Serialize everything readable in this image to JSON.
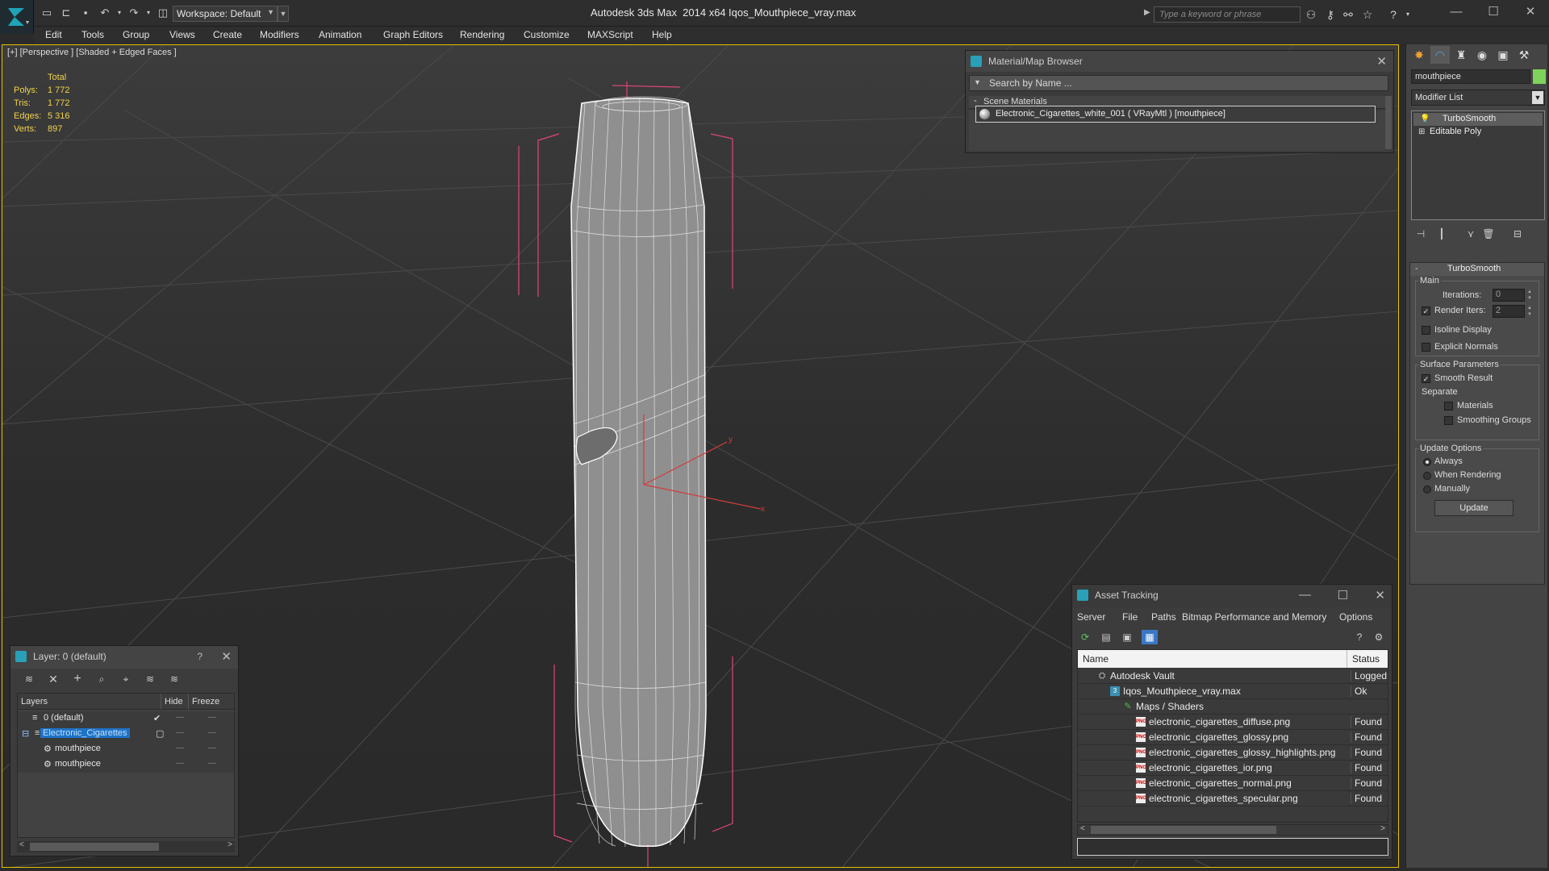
{
  "titlebar": {
    "workspace_label": "Workspace: Default",
    "app_title": "Autodesk 3ds Max  2014 x64",
    "file_title": "Iqos_Mouthpiece_vray.max",
    "search_placeholder": "Type a keyword or phrase"
  },
  "menu": [
    "Edit",
    "Tools",
    "Group",
    "Views",
    "Create",
    "Modifiers",
    "Animation",
    "Graph Editors",
    "Rendering",
    "Customize",
    "MAXScript",
    "Help"
  ],
  "viewport": {
    "label": "[+] [Perspective ] [Shaded + Edged Faces ]",
    "stats": {
      "header": "Total",
      "rows": [
        {
          "key": "Polys:",
          "value": "1 772"
        },
        {
          "key": "Tris:",
          "value": "1 772"
        },
        {
          "key": "Edges:",
          "value": "5 316"
        },
        {
          "key": "Verts:",
          "value": "897"
        }
      ]
    },
    "gizmo_labels": {
      "y": "y",
      "x": "x"
    },
    "colors": {
      "border": "#e5c100",
      "stats": "#f2d34a",
      "bbox": "#e0457b",
      "wire": "#ffffff"
    }
  },
  "material_browser": {
    "title": "Material/Map Browser",
    "search_placeholder": "Search by Name ...",
    "group_label": "Scene Materials",
    "item": "Electronic_Cigarettes_white_001  ( VRayMtl ) [mouthpiece]"
  },
  "command_panel": {
    "object_name": "mouthpiece",
    "modifier_list": "Modifier List",
    "stack": [
      "TurboSmooth",
      "Editable Poly"
    ],
    "turbosmooth": {
      "title": "TurboSmooth",
      "main_label": "Main",
      "iterations_label": "Iterations:",
      "iterations_value": "0",
      "render_iters_label": "Render Iters:",
      "render_iters_value": "2",
      "isoline_label": "Isoline Display",
      "explicit_label": "Explicit Normals",
      "surface_label": "Surface Parameters",
      "smooth_label": "Smooth Result",
      "separate_label": "Separate",
      "materials_label": "Materials",
      "smoothing_label": "Smoothing Groups",
      "update_label": "Update Options",
      "always_label": "Always",
      "when_rendering_label": "When Rendering",
      "manually_label": "Manually",
      "update_button": "Update"
    }
  },
  "layer_dialog": {
    "title": "Layer: 0 (default)",
    "help": "?",
    "col_layers": "Layers",
    "col_hide": "Hide",
    "col_freeze": "Freeze",
    "rows": [
      "0 (default)",
      "Electronic_Cigarettes",
      "mouthpiece",
      "mouthpiece"
    ]
  },
  "asset_tracking": {
    "title": "Asset Tracking",
    "menu": [
      "Server",
      "File",
      "Paths",
      "Bitmap Performance and Memory",
      "Options"
    ],
    "col_name": "Name",
    "col_status": "Status",
    "rows": [
      {
        "name": "Autodesk Vault",
        "status": "Logged O"
      },
      {
        "name": "Iqos_Mouthpiece_vray.max",
        "status": "Ok"
      },
      {
        "name": "Maps / Shaders",
        "status": ""
      },
      {
        "name": "electronic_cigarettes_diffuse.png",
        "status": "Found"
      },
      {
        "name": "electronic_cigarettes_glossy.png",
        "status": "Found"
      },
      {
        "name": "electronic_cigarettes_glossy_highlights.png",
        "status": "Found"
      },
      {
        "name": "electronic_cigarettes_ior.png",
        "status": "Found"
      },
      {
        "name": "electronic_cigarettes_normal.png",
        "status": "Found"
      },
      {
        "name": "electronic_cigarettes_specular.png",
        "status": "Found"
      }
    ]
  }
}
